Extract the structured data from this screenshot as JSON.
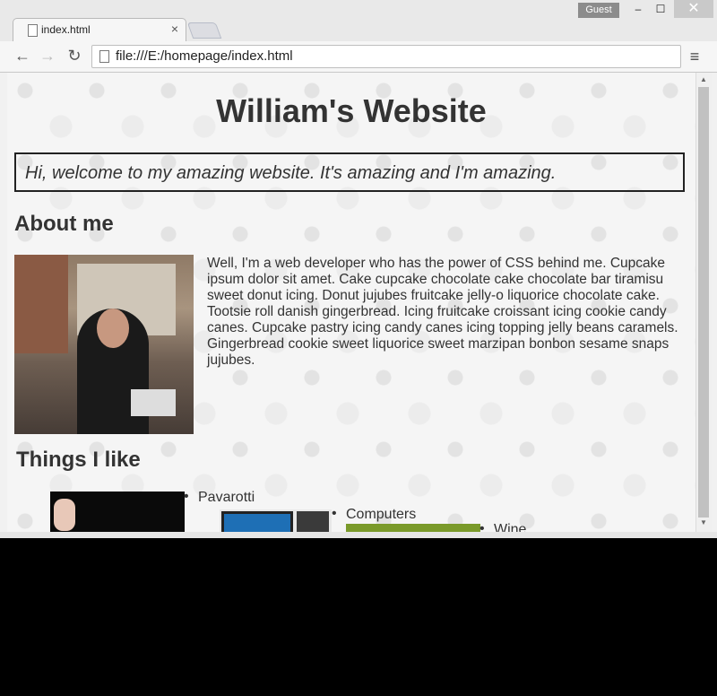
{
  "browser": {
    "tab_title": "index.html",
    "tab_close": "×",
    "profile": "Guest",
    "window_controls": {
      "minimize": "–",
      "maximize": "☐",
      "close": "✕"
    },
    "nav": {
      "back": "←",
      "forward": "→",
      "reload": "↻"
    },
    "url": "file:///E:/homepage/index.html",
    "menu": "≡"
  },
  "page": {
    "title": "William's Website",
    "welcome": "Hi, welcome to my amazing website. It's amazing and I'm amazing.",
    "about_heading": "About me",
    "about_text": "Well, I'm a web developer who has the power of CSS behind me. Cupcake ipsum dolor sit amet. Cake cupcake chocolate cake chocolate bar tiramisu sweet donut icing. Donut jujubes fruitcake jelly-o liquorice chocolate cake. Tootsie roll danish gingerbread. Icing fruitcake croissant icing cookie candy canes. Cupcake pastry icing candy canes icing topping jelly beans caramels. Gingerbread cookie sweet liquorice sweet marzipan bonbon sesame snaps jujubes.",
    "things_heading": "Things I like",
    "things": [
      "Pavarotti",
      "Computers",
      "Wine"
    ]
  }
}
